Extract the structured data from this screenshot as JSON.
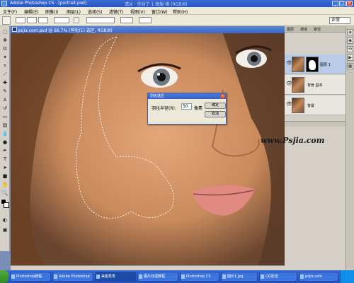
{
  "app_window": {
    "title": "Adobe Photoshop CS - [portrait.psd]",
    "dimmed_text": "请从 · 你对了 1 图层 相 (RGB/8)"
  },
  "menubar": {
    "items": [
      "文件(F)",
      "编辑(E)",
      "图像(I)",
      "图层(L)",
      "选择(S)",
      "滤镜(T)",
      "视图(V)",
      "窗口(W)",
      "帮助(H)"
    ]
  },
  "options_bar": {
    "dropdown_label": "正常"
  },
  "document": {
    "title": "psjia.com.psd @ 66.7% (羽化(1) 选区, RGB/8)"
  },
  "watermark": "www.Psjia.com",
  "feather_dialog": {
    "title": "羽化选区",
    "field_label": "羽化半径(R):",
    "value": "50",
    "unit": "像素",
    "ok_label": "确定",
    "cancel_label": "取消"
  },
  "layers_panel": {
    "tabs": [
      "图层",
      "通道",
      "路径"
    ],
    "layers": [
      {
        "name": "图层 1",
        "active": true,
        "has_mask": true
      },
      {
        "name": "背景 副本",
        "active": false,
        "has_mask": false
      },
      {
        "name": "背景",
        "active": false,
        "has_mask": false
      }
    ]
  },
  "taskbar": {
    "tasks": [
      "Photoshop教程",
      "Adobe Photoshop",
      "美图秀秀",
      "图片处理教程",
      "Photoshop CS",
      "图片1.jpg",
      "QQ影音",
      "psjia.com"
    ]
  },
  "colors": {
    "titlebar": "#2456c4",
    "dialog_border": "#3a5ca8",
    "selected_layer": "#b8cce8",
    "start_button": "#2f8a22"
  }
}
